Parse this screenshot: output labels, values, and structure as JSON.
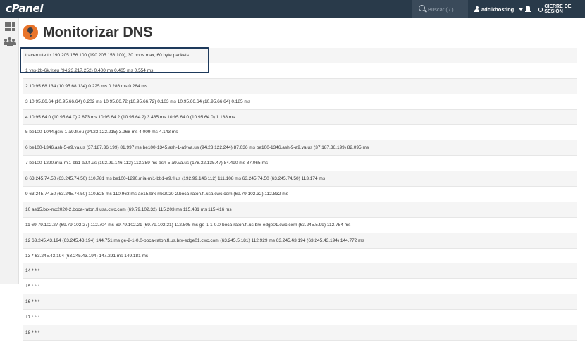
{
  "topbar": {
    "logo_text": "cPanel",
    "search_placeholder": "Buscar ( / )",
    "username": "adcikhosting",
    "logout_label": "CIERRE DE SESIÓN"
  },
  "page": {
    "title": "Monitorizar DNS"
  },
  "results": [
    "traceroute to 190.205.156.100 (190.205.156.100), 30 hops max, 60 byte packets",
    "1 vss-2b-6k.fr.eu (94.23.217.252) 0.400 ms 0.465 ms 0.554 ms",
    "2 10.95.68.134 (10.95.68.134) 0.225 ms 0.286 ms 0.284 ms",
    "3 10.95.66.64 (10.95.66.64) 0.202 ms 10.95.66.72 (10.95.66.72) 0.163 ms 10.95.66.64 (10.95.66.64) 0.185 ms",
    "4 10.95.64.0 (10.95.64.0) 2.873 ms 10.95.64.2 (10.95.64.2) 3.485 ms 10.95.64.0 (10.95.64.0) 1.188 ms",
    "5 be100-1044.gsw-1-a9.fr.eu (94.23.122.215) 3.968 ms 4.009 ms 4.143 ms",
    "6 be100-1346.ash-5-a9.va.us (37.187.36.199) 81.997 ms be100-1345.ash-1-a9.va.us (94.23.122.244) 87.036 ms be100-1346.ash-5-a9.va.us (37.187.36.199) 82.095 ms",
    "7 be100-1290.mia-mi1-bb1-a9.fl.us (192.99.146.112) 113.359 ms ash-5-a9.va.us (178.32.135.47) 84.490 ms 87.065 ms",
    "8 63.245.74.50 (63.245.74.50) 110.781 ms be100-1290.mia-mi1-bb1-a9.fl.us (192.99.146.112) 111.108 ms 63.245.74.50 (63.245.74.50) 113.174 ms",
    "9 63.245.74.50 (63.245.74.50) 110.628 ms 110.963 ms ae15.brx-mx2020-2.boca-raton.fl.usa.cwc.com (69.79.102.32) 112.832 ms",
    "10 ae15.brx-mx2020-2.boca-raton.fl.usa.cwc.com (69.79.102.32) 115.203 ms 115.431 ms 115.416 ms",
    "11 69.79.102.27 (69.79.102.27) 112.704 ms 69.79.102.21 (69.79.102.21) 112.505 ms ge-1-1-0.0-boca-raton.fl.us.brx-edge01.cwc.com (63.245.5.99) 112.754 ms",
    "12 63.245.43.194 (63.245.43.194) 144.751 ms ge-2-1-0.0-boca-raton.fl.us.brx-edge01.cwc.com (63.245.5.181) 112.929 ms 63.245.43.194 (63.245.43.194) 144.772 ms",
    "13 * 63.245.43.194 (63.245.43.194) 147.291 ms 149.181 ms",
    "14 * * *",
    "15 * * *",
    "16 * * *",
    "17 * * *",
    "18 * * *"
  ]
}
